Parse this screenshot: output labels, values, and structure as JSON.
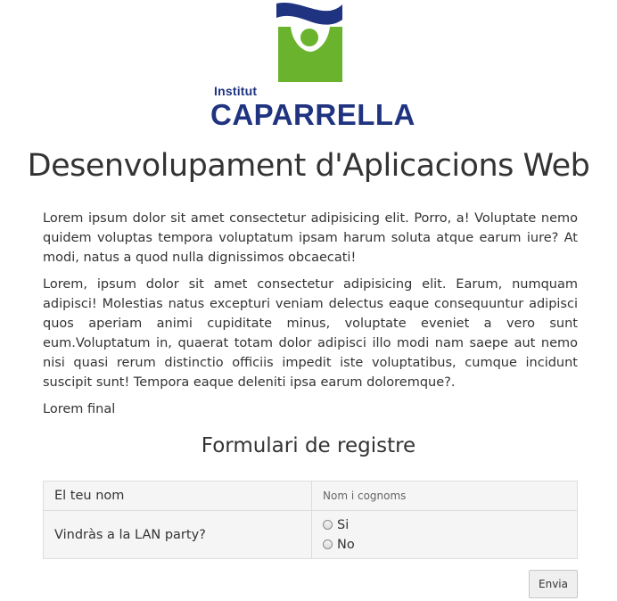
{
  "logo": {
    "line1": "Institut",
    "line2": "CAPARRELLA",
    "colors": {
      "blue": "#1f3381",
      "green": "#6ab42d"
    }
  },
  "header": {
    "title": "Desenvolupament d'Aplicacions Web"
  },
  "content": {
    "paragraphs": [
      "Lorem ipsum dolor sit amet consectetur adipisicing elit. Porro, a! Voluptate nemo quidem voluptas tempora voluptatum ipsam harum soluta atque earum iure? At modi, natus a quod nulla dignissimos obcaecati!",
      "Lorem, ipsum dolor sit amet consectetur adipisicing elit. Earum, numquam adipisci! Molestias natus excepturi veniam delectus eaque consequuntur adipisci quos aperiam animi cupiditate minus, voluptate eveniet a vero sunt eum.Voluptatum in, quaerat totam dolor adipisci illo modi nam saepe aut nemo nisi quasi rerum distinctio officiis impedit iste voluptatibus, cumque incidunt suscipit sunt! Tempora eaque deleniti ipsa earum doloremque?.",
      "Lorem final"
    ]
  },
  "form": {
    "title": "Formulari de registre",
    "name_label": "El teu nom",
    "name_placeholder": "Nom i cognoms",
    "name_value": "",
    "lan_label": "Vindràs a la LAN party?",
    "options": [
      "Si",
      "No"
    ],
    "submit_label": "Envia"
  }
}
